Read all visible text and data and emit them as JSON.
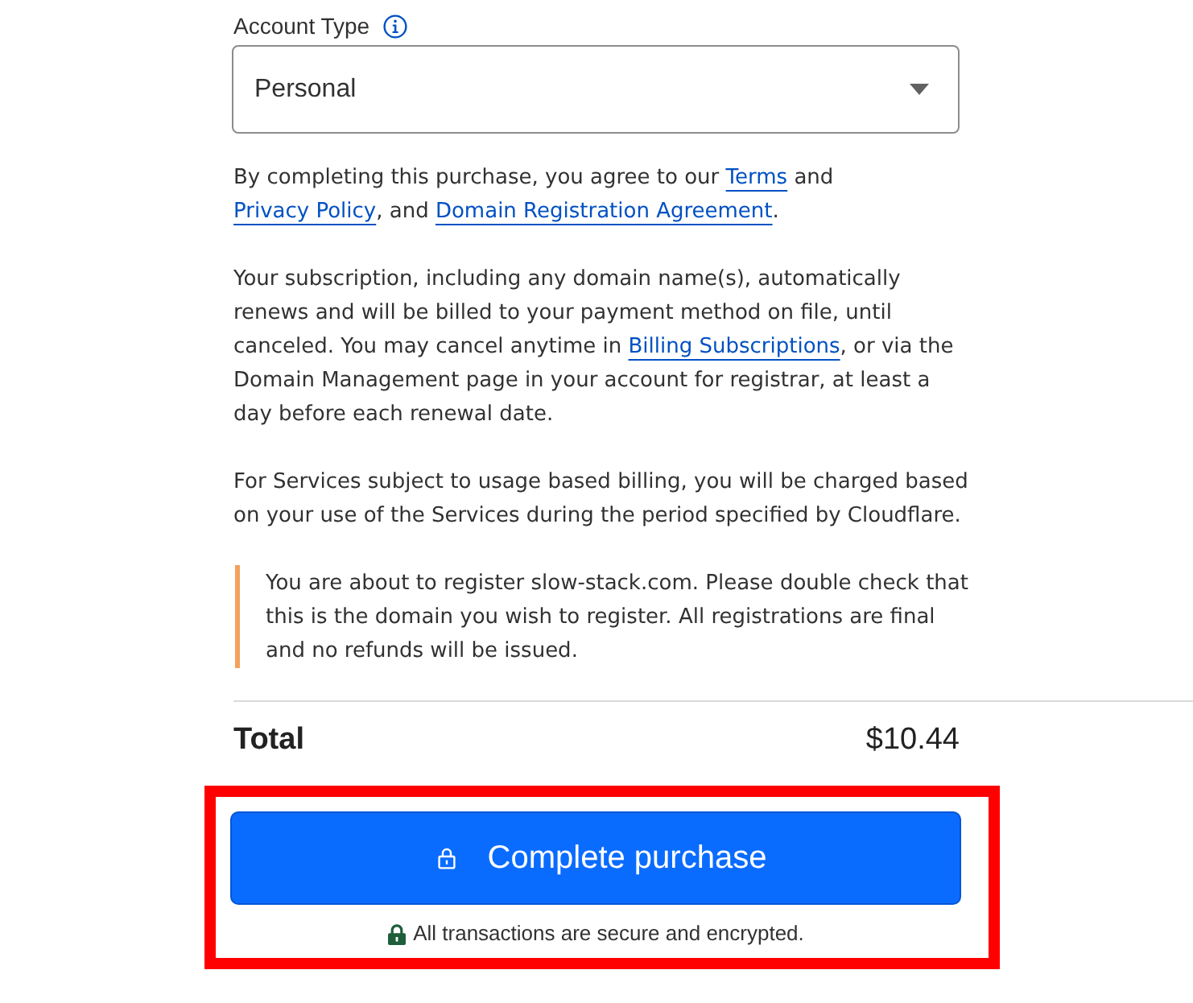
{
  "account_type": {
    "label": "Account Type",
    "value": "Personal"
  },
  "paragraphs": [
    {
      "parts": [
        {
          "kind": "text",
          "text": "By completing this purchase, you agree to our "
        },
        {
          "kind": "link",
          "text": "Terms"
        },
        {
          "kind": "text",
          "text": " and "
        },
        {
          "kind": "link",
          "text": "Privacy Policy"
        },
        {
          "kind": "text",
          "text": ", and "
        },
        {
          "kind": "link",
          "text": "Domain Registration Agreement"
        },
        {
          "kind": "text",
          "text": "."
        }
      ]
    },
    {
      "parts": [
        {
          "kind": "text",
          "text": "Your subscription, including any domain name(s), automatically renews and will be billed to your payment method on file, until canceled. You may cancel anytime in "
        },
        {
          "kind": "link",
          "text": "Billing Subscriptions"
        },
        {
          "kind": "text",
          "text": ", or via the Domain Management page in your account for registrar, at least a day before each renewal date."
        }
      ]
    },
    {
      "parts": [
        {
          "kind": "text",
          "text": "For Services subject to usage based billing, you will be charged based on your use of the Services during the period specified by Cloudflare."
        }
      ]
    }
  ],
  "warning": {
    "text": "You are about to register slow-stack.com. Please double check that this is the domain you wish to register. All registrations are final and no refunds will be issued."
  },
  "total": {
    "label": "Total",
    "amount": "$10.44"
  },
  "purchase": {
    "highlighted": true,
    "button": "Complete purchase",
    "secure_note": "All transactions are secure and encrypted."
  }
}
